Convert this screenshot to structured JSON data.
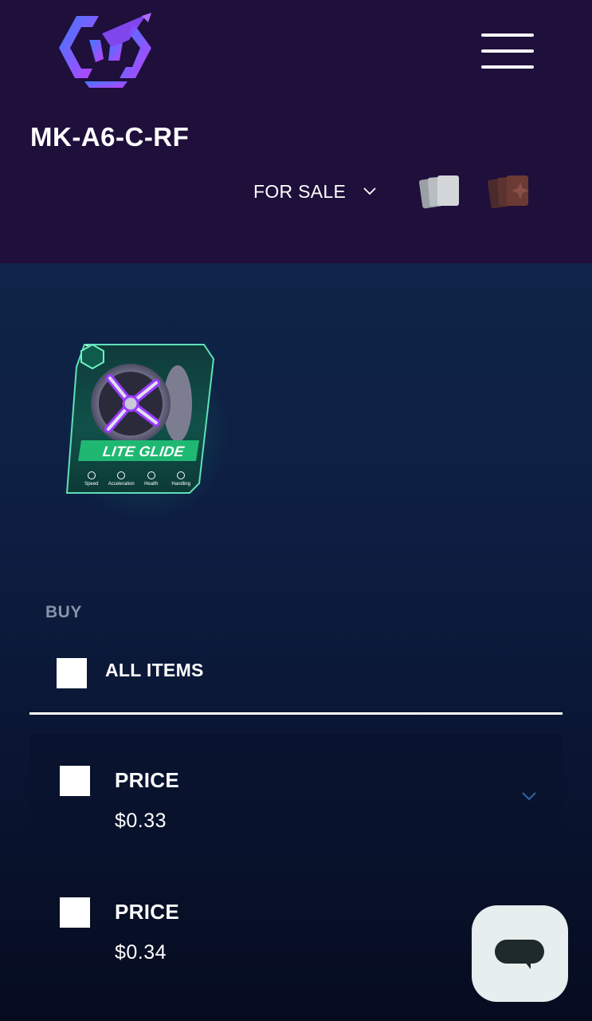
{
  "header": {
    "menu_icon": "hamburger-menu-icon",
    "title": "MK-A6-C-RF",
    "sale_filter": {
      "selected": "FOR SALE",
      "icon": "chevron-down-icon"
    },
    "view_icons": [
      "cards-stack-icon",
      "packs-icon"
    ]
  },
  "item": {
    "name": "LITE GLIDE",
    "badge": "-",
    "stats": [
      "Speed",
      "Acceleration",
      "Health",
      "Handling"
    ]
  },
  "buy": {
    "heading": "BUY",
    "all_items_label": "ALL ITEMS",
    "listings": [
      {
        "label": "PRICE",
        "price": "$0.33"
      },
      {
        "label": "PRICE",
        "price": "$0.34"
      }
    ]
  },
  "chat": {
    "icon": "chat-bubble-icon"
  },
  "colors": {
    "header_bg": "#1e0f3b",
    "content_bg": "#0d1e42",
    "card_accent": "#22c47a",
    "logo_gradient": [
      "#3a7bff",
      "#c040ff"
    ]
  }
}
